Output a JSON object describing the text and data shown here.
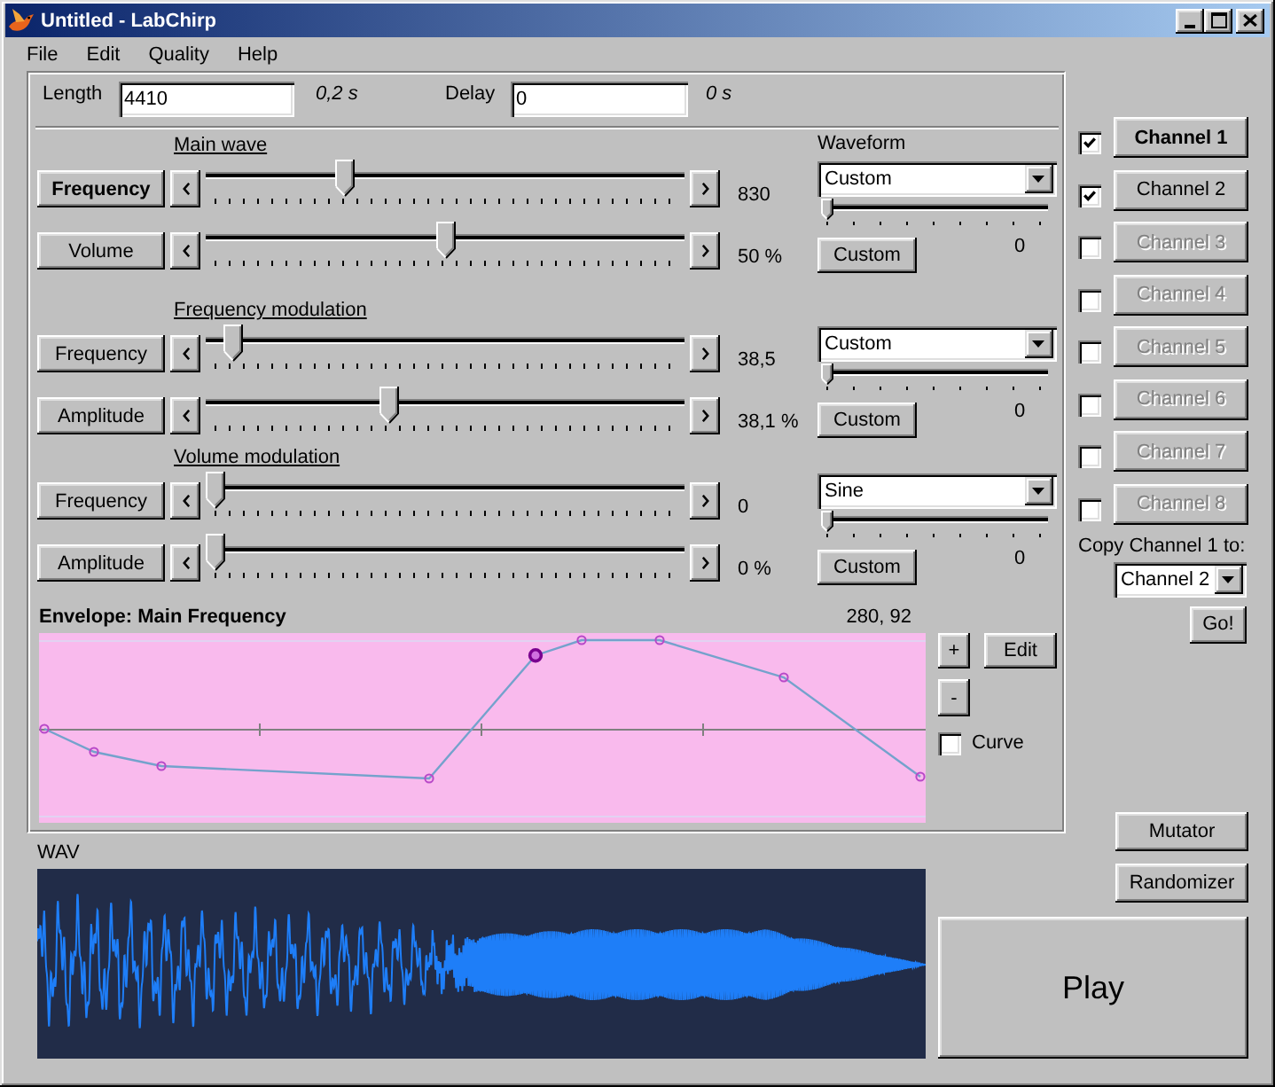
{
  "window": {
    "title": "Untitled - LabChirp"
  },
  "menu": [
    "File",
    "Edit",
    "Quality",
    "Help"
  ],
  "timing": {
    "length": {
      "label": "Length",
      "value": "4410",
      "duration": "0,2 s"
    },
    "delay": {
      "label": "Delay",
      "value": "0",
      "duration": "0 s"
    }
  },
  "sections": [
    {
      "title": "Main wave",
      "waveform_label": "Waveform",
      "waveform": {
        "value": "Custom",
        "level": 0,
        "button": "Custom",
        "reading": "0"
      },
      "params": [
        {
          "label": "Frequency",
          "selected": true,
          "level": 0.28,
          "reading": "830"
        },
        {
          "label": "Volume",
          "selected": false,
          "level": 0.5,
          "reading": "50 %"
        }
      ]
    },
    {
      "title": "Frequency modulation",
      "waveform": {
        "value": "Custom",
        "level": 0,
        "button": "Custom",
        "reading": "0"
      },
      "params": [
        {
          "label": "Frequency",
          "selected": false,
          "level": 0.04,
          "reading": "38,5"
        },
        {
          "label": "Amplitude",
          "selected": false,
          "level": 0.38,
          "reading": "38,1 %"
        }
      ]
    },
    {
      "title": "Volume modulation",
      "waveform": {
        "value": "Sine",
        "level": 0,
        "button": "Custom",
        "reading": "0"
      },
      "params": [
        {
          "label": "Frequency",
          "selected": false,
          "level": 0,
          "reading": "0"
        },
        {
          "label": "Amplitude",
          "selected": false,
          "level": 0,
          "reading": "0 %"
        }
      ]
    }
  ],
  "envelope": {
    "title": "Envelope: Main Frequency",
    "readout": "280, 92",
    "add_button": "+",
    "remove_button": "-",
    "edit_button": "Edit",
    "curve": {
      "label": "Curve",
      "checked": false
    },
    "points": [
      {
        "selected": false
      },
      {
        "selected": false
      },
      {
        "selected": false
      },
      {
        "selected": false
      },
      {
        "selected": true
      },
      {
        "selected": false
      },
      {
        "selected": false
      },
      {
        "selected": false
      },
      {
        "selected": false
      }
    ]
  },
  "wav": {
    "label": "WAV"
  },
  "channels": [
    {
      "label": "Channel 1",
      "checked": true,
      "selected": true,
      "disabled": false
    },
    {
      "label": "Channel 2",
      "checked": true,
      "selected": false,
      "disabled": false
    },
    {
      "label": "Channel 3",
      "checked": false,
      "selected": false,
      "disabled": true
    },
    {
      "label": "Channel 4",
      "checked": false,
      "selected": false,
      "disabled": true
    },
    {
      "label": "Channel 5",
      "checked": false,
      "selected": false,
      "disabled": true
    },
    {
      "label": "Channel 6",
      "checked": false,
      "selected": false,
      "disabled": true
    },
    {
      "label": "Channel 7",
      "checked": false,
      "selected": false,
      "disabled": true
    },
    {
      "label": "Channel 8",
      "checked": false,
      "selected": false,
      "disabled": true
    }
  ],
  "copy": {
    "label": "Copy Channel 1 to:",
    "target": "Channel 2",
    "button": "Go!"
  },
  "actions": {
    "mutator": "Mutator",
    "randomizer": "Randomizer",
    "play": "Play"
  }
}
